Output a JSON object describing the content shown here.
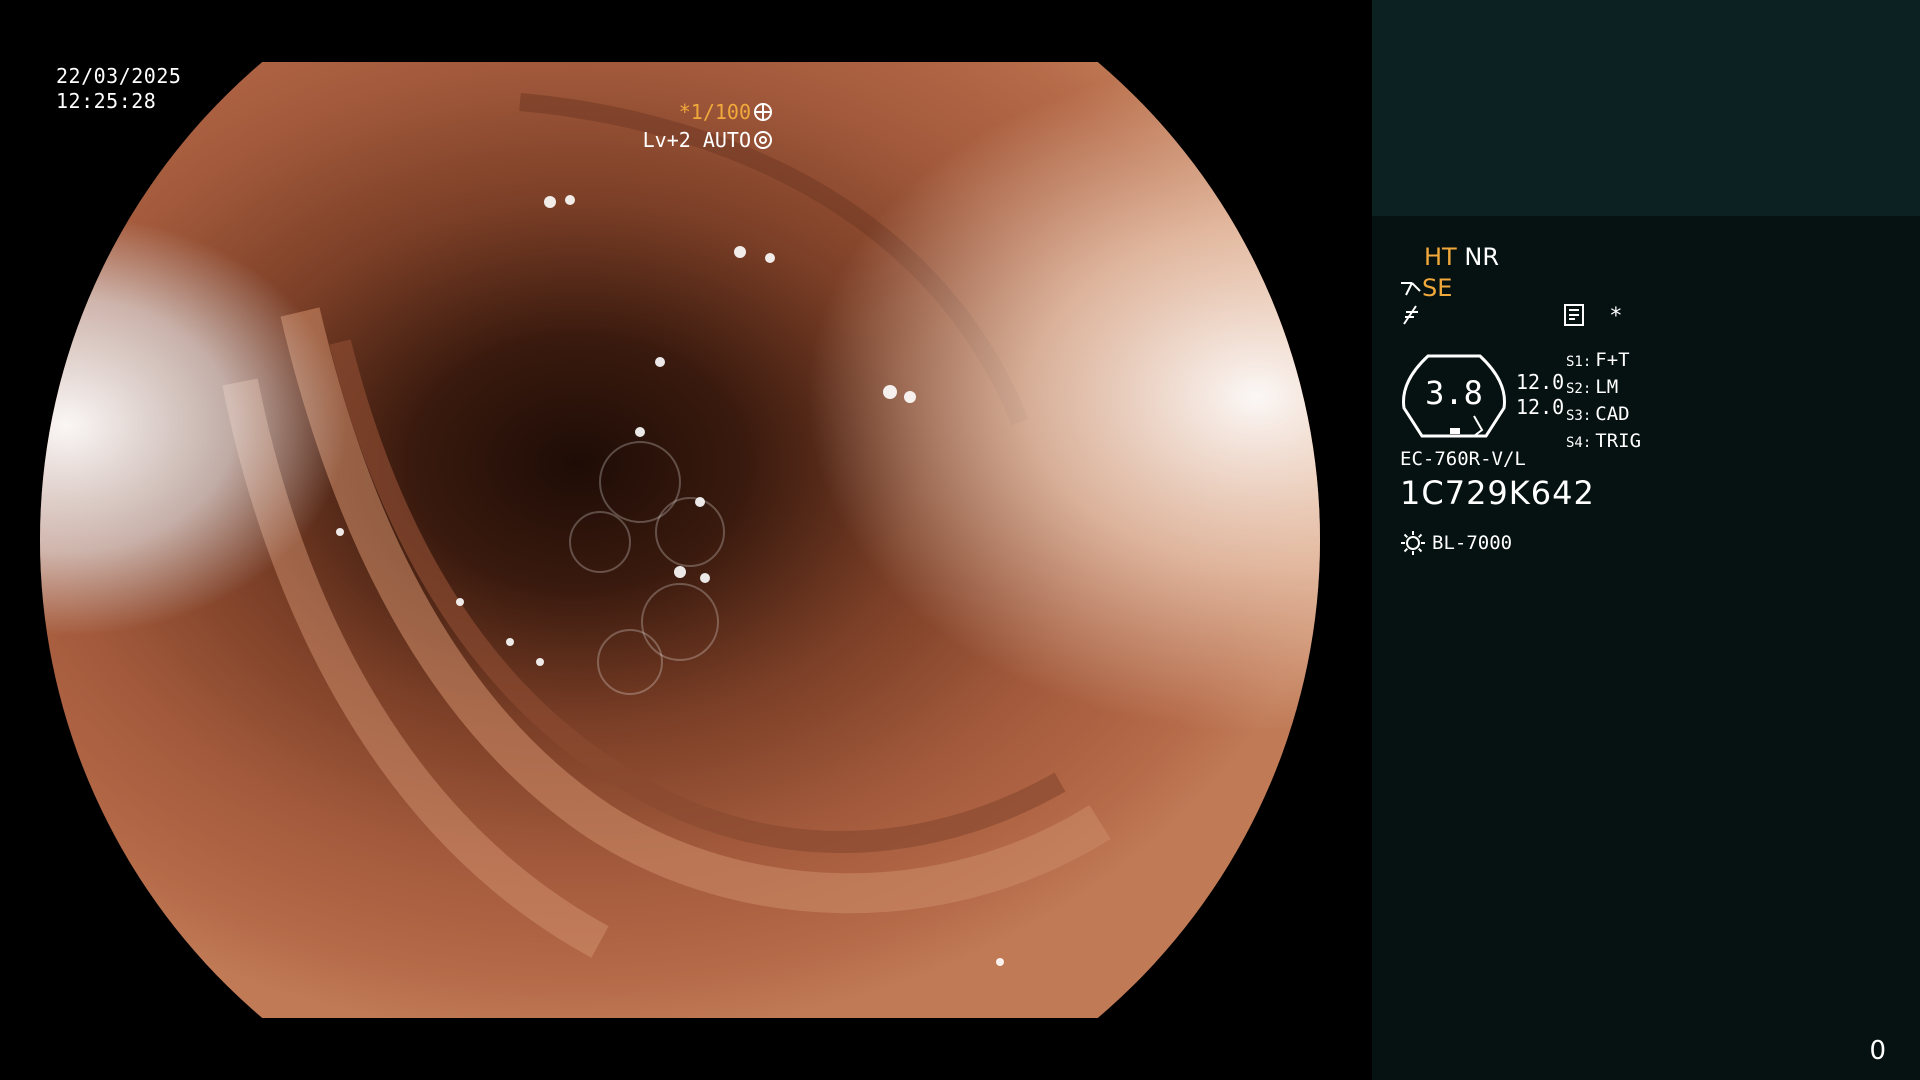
{
  "overlay": {
    "date": "22/03/2025",
    "time": "12:25:28",
    "shutter": "*1/100",
    "iris": "Lv+2 AUTO"
  },
  "panel": {
    "ht": "HT",
    "nr": "NR",
    "se": "SE",
    "star": "*",
    "gauge_value": "3.8",
    "gauge_side_1": "12.0",
    "gauge_side_2": "12.0",
    "s_keys": [
      {
        "key": "S1:",
        "value": "F+T"
      },
      {
        "key": "S2:",
        "value": "LM"
      },
      {
        "key": "S3:",
        "value": "CAD"
      },
      {
        "key": "S4:",
        "value": "TRIG"
      }
    ],
    "scope_model": "EC-760R-V/L",
    "serial": "1C729K642",
    "light_source": "BL-7000",
    "counter": "0"
  },
  "colors": {
    "accent": "#f2a93b",
    "panel_bg": "#061211",
    "panel_top_bg": "#0c2222"
  }
}
